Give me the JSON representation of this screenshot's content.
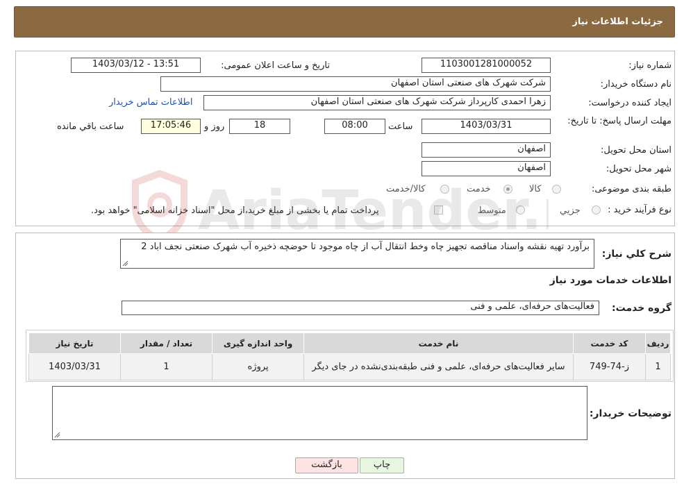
{
  "header": {
    "title": "جزئیات اطلاعات نیاز"
  },
  "details": {
    "need_number_label": "شماره نیاز:",
    "need_number": "1103001281000052",
    "announce_label": "تاریخ و ساعت اعلان عمومی:",
    "announce_value": "1403/03/12 - 13:51",
    "buyer_org_label": "نام دستگاه خریدار:",
    "buyer_org": "شرکت شهرک های صنعتی استان اصفهان",
    "requester_label": "ایجاد کننده درخواست:",
    "requester": "زهرا احمدی کارپرداز شرکت شهرک های صنعتی استان اصفهان",
    "buyer_contact_link": "اطلاعات تماس خریدار",
    "deadline_label": "مهلت ارسال پاسخ: تا تاریخ:",
    "deadline_date": "1403/03/31",
    "time_label": "ساعت",
    "deadline_time": "08:00",
    "days_value": "18",
    "days_label": "روز و",
    "remaining_time": "17:05:46",
    "remaining_label": "ساعت باقي مانده",
    "province_label": "استان محل تحویل:",
    "province": "اصفهان",
    "city_label": "شهر محل تحویل:",
    "city": "اصفهان",
    "category_label": "طبقه بندی موضوعی:",
    "category_options": [
      {
        "label": "کالا",
        "checked": false
      },
      {
        "label": "خدمت",
        "checked": true
      },
      {
        "label": "کالا/خدمت",
        "checked": false
      }
    ],
    "purchase_type_label": "نوع فرآیند خرید :",
    "purchase_type_options": [
      {
        "label": "جزیي",
        "checked": false
      },
      {
        "label": "متوسط",
        "checked": false
      }
    ],
    "payment_note": "پرداخت تمام یا بخشی از مبلغ خرید،از محل \"اسناد خزانه اسلامی\" خواهد بود.",
    "payment_checked": false
  },
  "need": {
    "summary_label": "شرح کلي نياز:",
    "summary_text": "برآورد تهیه نقشه واسناد مناقصه تجهیز چاه وخط انتقال آب از چاه موجود تا حوضچه ذخیره آب شهرک صنعتی نجف اباد 2",
    "services_heading": "اطلاعات خدمات مورد نیاز",
    "service_group_label": "گروه خدمت:",
    "service_group_value": "فعالیت‌های حرفه‌ای، علمی و فنی",
    "table": {
      "columns": [
        "ردیف",
        "کد خدمت",
        "نام خدمت",
        "واحد اندازه گیری",
        "تعداد / مقدار",
        "تاریخ نیاز"
      ],
      "rows": [
        [
          "1",
          "ز-74-749",
          "سایر فعالیت‌های حرفه‌ای، علمی و فنی طبقه‌بندی‌نشده در جای دیگر",
          "پروژه",
          "1",
          "1403/03/31"
        ]
      ]
    },
    "buyer_notes_label": "توضیحات خریدار:",
    "buyer_notes_value": ""
  },
  "buttons": {
    "print": "چاپ",
    "back": "بازگشت"
  },
  "watermark": {
    "text": "AriaTender.neT"
  }
}
